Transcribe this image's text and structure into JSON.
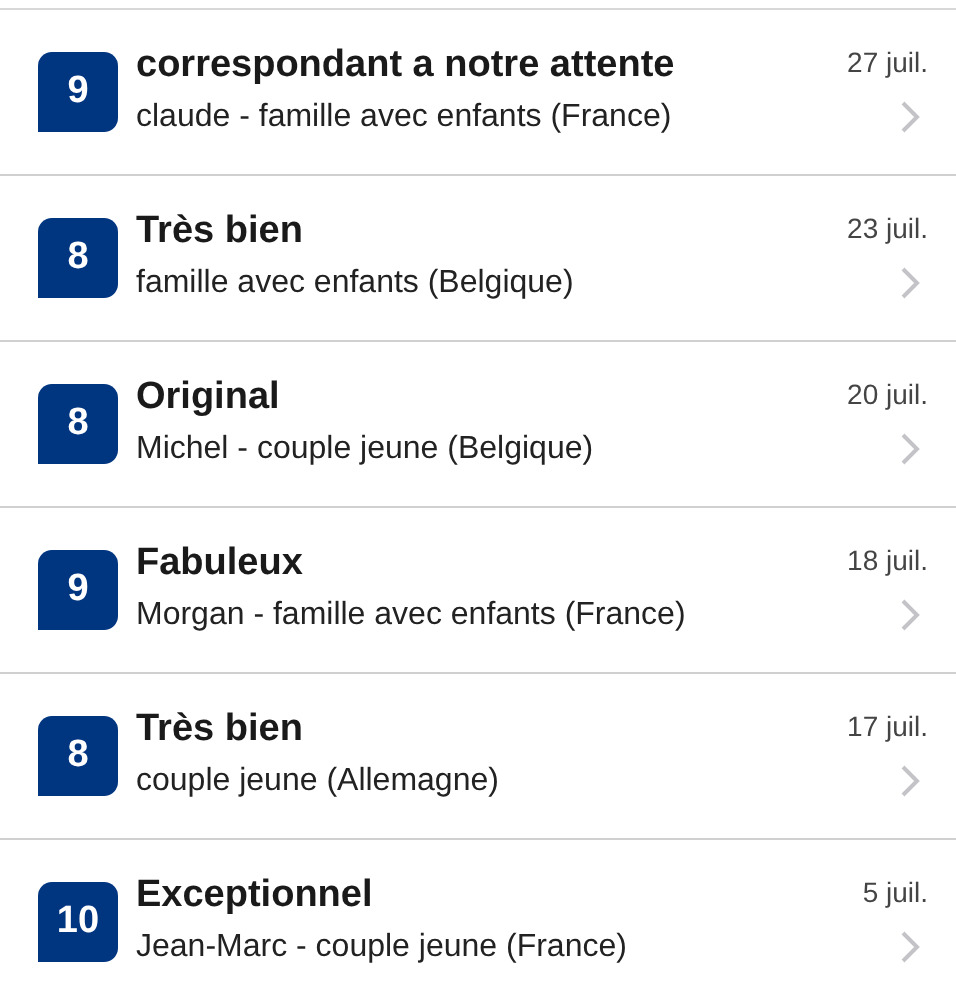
{
  "reviews": [
    {
      "score": "9",
      "title": "correspondant a notre attente",
      "reviewer": "claude - famille avec enfants (France)",
      "date": "27 juil."
    },
    {
      "score": "8",
      "title": "Très bien",
      "reviewer": "famille avec enfants (Belgique)",
      "date": "23 juil."
    },
    {
      "score": "8",
      "title": "Original",
      "reviewer": "Michel - couple jeune (Belgique)",
      "date": "20 juil."
    },
    {
      "score": "9",
      "title": "Fabuleux",
      "reviewer": "Morgan - famille avec enfants (France)",
      "date": "18 juil."
    },
    {
      "score": "8",
      "title": "Très bien",
      "reviewer": "couple jeune (Allemagne)",
      "date": "17 juil."
    },
    {
      "score": "10",
      "title": "Exceptionnel",
      "reviewer": "Jean-Marc - couple jeune (France)",
      "date": "5 juil."
    }
  ]
}
